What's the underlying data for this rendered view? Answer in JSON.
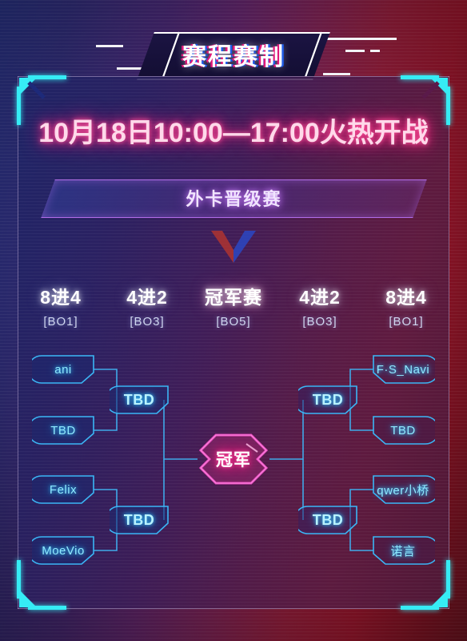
{
  "banner": {
    "title": "赛程赛制"
  },
  "date_line": "10月18日10:00—17:00火热开战",
  "section": {
    "title": "外卡晋级赛"
  },
  "emblem": {
    "name": "chevron-emblem",
    "left_color": "#b3352f",
    "right_color": "#2a49c8"
  },
  "rounds": [
    {
      "name": "8进4",
      "format": "[BO1]"
    },
    {
      "name": "4进2",
      "format": "[BO3]"
    },
    {
      "name": "冠军赛",
      "format": "[BO5]"
    },
    {
      "name": "4进2",
      "format": "[BO3]"
    },
    {
      "name": "8进4",
      "format": "[BO1]"
    }
  ],
  "bracket": {
    "left": {
      "quarterfinals": [
        "ani",
        "TBD",
        "Felix",
        "MoeVio"
      ],
      "semifinals": [
        "TBD",
        "TBD"
      ]
    },
    "right": {
      "quarterfinals": [
        "F·S_Navi",
        "TBD",
        "qwer小桥",
        "诺言"
      ],
      "semifinals": [
        "TBD",
        "TBD"
      ]
    },
    "champion": "冠军"
  },
  "colors": {
    "cyan": "#36ecf5",
    "team_border": "#3bb6f5",
    "team_text": "#8fe9ff",
    "pink": "#ff2f86",
    "purple": "#b16ce8",
    "panel_left": "#1e2466",
    "panel_right": "#4e193a"
  }
}
